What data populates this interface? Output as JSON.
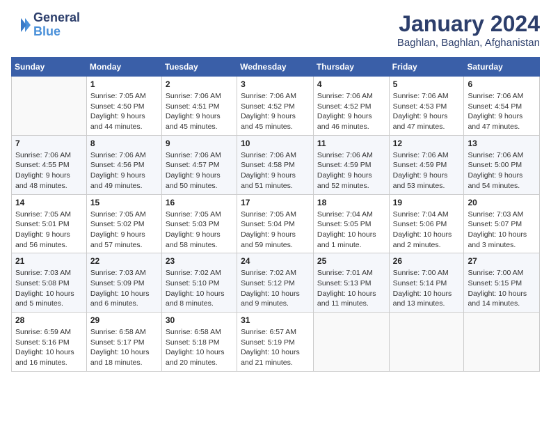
{
  "header": {
    "logo_line1": "General",
    "logo_line2": "Blue",
    "month": "January 2024",
    "location": "Baghlan, Baghlan, Afghanistan"
  },
  "weekdays": [
    "Sunday",
    "Monday",
    "Tuesday",
    "Wednesday",
    "Thursday",
    "Friday",
    "Saturday"
  ],
  "weeks": [
    [
      {
        "day": "",
        "info": ""
      },
      {
        "day": "1",
        "info": "Sunrise: 7:05 AM\nSunset: 4:50 PM\nDaylight: 9 hours\nand 44 minutes."
      },
      {
        "day": "2",
        "info": "Sunrise: 7:06 AM\nSunset: 4:51 PM\nDaylight: 9 hours\nand 45 minutes."
      },
      {
        "day": "3",
        "info": "Sunrise: 7:06 AM\nSunset: 4:52 PM\nDaylight: 9 hours\nand 45 minutes."
      },
      {
        "day": "4",
        "info": "Sunrise: 7:06 AM\nSunset: 4:52 PM\nDaylight: 9 hours\nand 46 minutes."
      },
      {
        "day": "5",
        "info": "Sunrise: 7:06 AM\nSunset: 4:53 PM\nDaylight: 9 hours\nand 47 minutes."
      },
      {
        "day": "6",
        "info": "Sunrise: 7:06 AM\nSunset: 4:54 PM\nDaylight: 9 hours\nand 47 minutes."
      }
    ],
    [
      {
        "day": "7",
        "info": "Sunrise: 7:06 AM\nSunset: 4:55 PM\nDaylight: 9 hours\nand 48 minutes."
      },
      {
        "day": "8",
        "info": "Sunrise: 7:06 AM\nSunset: 4:56 PM\nDaylight: 9 hours\nand 49 minutes."
      },
      {
        "day": "9",
        "info": "Sunrise: 7:06 AM\nSunset: 4:57 PM\nDaylight: 9 hours\nand 50 minutes."
      },
      {
        "day": "10",
        "info": "Sunrise: 7:06 AM\nSunset: 4:58 PM\nDaylight: 9 hours\nand 51 minutes."
      },
      {
        "day": "11",
        "info": "Sunrise: 7:06 AM\nSunset: 4:59 PM\nDaylight: 9 hours\nand 52 minutes."
      },
      {
        "day": "12",
        "info": "Sunrise: 7:06 AM\nSunset: 4:59 PM\nDaylight: 9 hours\nand 53 minutes."
      },
      {
        "day": "13",
        "info": "Sunrise: 7:06 AM\nSunset: 5:00 PM\nDaylight: 9 hours\nand 54 minutes."
      }
    ],
    [
      {
        "day": "14",
        "info": "Sunrise: 7:05 AM\nSunset: 5:01 PM\nDaylight: 9 hours\nand 56 minutes."
      },
      {
        "day": "15",
        "info": "Sunrise: 7:05 AM\nSunset: 5:02 PM\nDaylight: 9 hours\nand 57 minutes."
      },
      {
        "day": "16",
        "info": "Sunrise: 7:05 AM\nSunset: 5:03 PM\nDaylight: 9 hours\nand 58 minutes."
      },
      {
        "day": "17",
        "info": "Sunrise: 7:05 AM\nSunset: 5:04 PM\nDaylight: 9 hours\nand 59 minutes."
      },
      {
        "day": "18",
        "info": "Sunrise: 7:04 AM\nSunset: 5:05 PM\nDaylight: 10 hours\nand 1 minute."
      },
      {
        "day": "19",
        "info": "Sunrise: 7:04 AM\nSunset: 5:06 PM\nDaylight: 10 hours\nand 2 minutes."
      },
      {
        "day": "20",
        "info": "Sunrise: 7:03 AM\nSunset: 5:07 PM\nDaylight: 10 hours\nand 3 minutes."
      }
    ],
    [
      {
        "day": "21",
        "info": "Sunrise: 7:03 AM\nSunset: 5:08 PM\nDaylight: 10 hours\nand 5 minutes."
      },
      {
        "day": "22",
        "info": "Sunrise: 7:03 AM\nSunset: 5:09 PM\nDaylight: 10 hours\nand 6 minutes."
      },
      {
        "day": "23",
        "info": "Sunrise: 7:02 AM\nSunset: 5:10 PM\nDaylight: 10 hours\nand 8 minutes."
      },
      {
        "day": "24",
        "info": "Sunrise: 7:02 AM\nSunset: 5:12 PM\nDaylight: 10 hours\nand 9 minutes."
      },
      {
        "day": "25",
        "info": "Sunrise: 7:01 AM\nSunset: 5:13 PM\nDaylight: 10 hours\nand 11 minutes."
      },
      {
        "day": "26",
        "info": "Sunrise: 7:00 AM\nSunset: 5:14 PM\nDaylight: 10 hours\nand 13 minutes."
      },
      {
        "day": "27",
        "info": "Sunrise: 7:00 AM\nSunset: 5:15 PM\nDaylight: 10 hours\nand 14 minutes."
      }
    ],
    [
      {
        "day": "28",
        "info": "Sunrise: 6:59 AM\nSunset: 5:16 PM\nDaylight: 10 hours\nand 16 minutes."
      },
      {
        "day": "29",
        "info": "Sunrise: 6:58 AM\nSunset: 5:17 PM\nDaylight: 10 hours\nand 18 minutes."
      },
      {
        "day": "30",
        "info": "Sunrise: 6:58 AM\nSunset: 5:18 PM\nDaylight: 10 hours\nand 20 minutes."
      },
      {
        "day": "31",
        "info": "Sunrise: 6:57 AM\nSunset: 5:19 PM\nDaylight: 10 hours\nand 21 minutes."
      },
      {
        "day": "",
        "info": ""
      },
      {
        "day": "",
        "info": ""
      },
      {
        "day": "",
        "info": ""
      }
    ]
  ]
}
